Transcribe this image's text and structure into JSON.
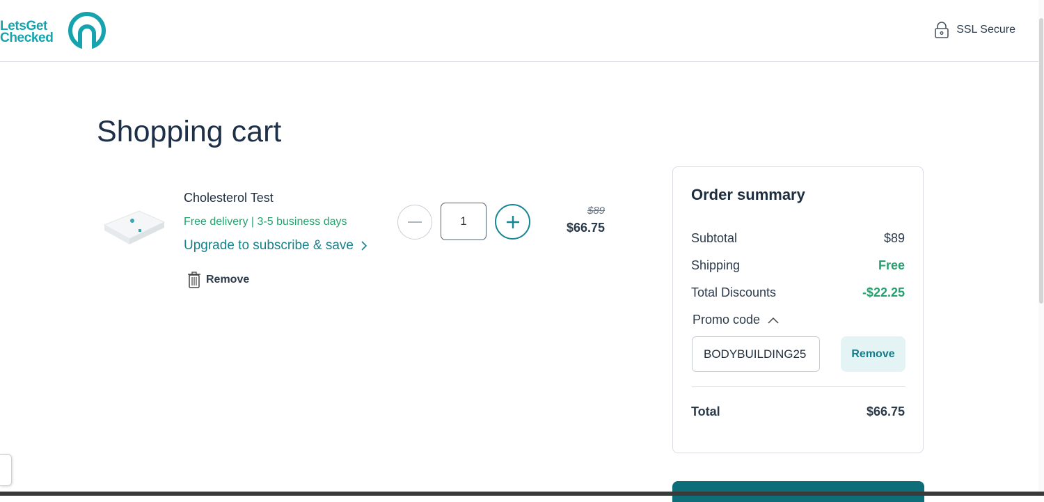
{
  "header": {
    "logo_line1": "LetsGet",
    "logo_line2": "Checked",
    "ssl_label": "SSL Secure"
  },
  "page": {
    "title": "Shopping cart"
  },
  "cart_item": {
    "name": "Cholesterol Test",
    "delivery": "Free delivery | 3-5 business days",
    "upgrade_label": "Upgrade to subscribe & save",
    "remove_label": "Remove",
    "quantity": "1",
    "old_price": "$89",
    "price": "$66.75"
  },
  "summary": {
    "title": "Order summary",
    "subtotal_label": "Subtotal",
    "subtotal_value": "$89",
    "shipping_label": "Shipping",
    "shipping_value": "Free",
    "discounts_label": "Total Discounts",
    "discounts_value": "-$22.25",
    "promo_label": "Promo code",
    "promo_value": "BODYBUILDING25",
    "promo_remove_label": "Remove",
    "total_label": "Total",
    "total_value": "$66.75"
  },
  "colors": {
    "brand": "#16a3ad",
    "accent_green": "#23a26f",
    "link_teal": "#17828c",
    "checkout_button": "#0d6e7a"
  }
}
